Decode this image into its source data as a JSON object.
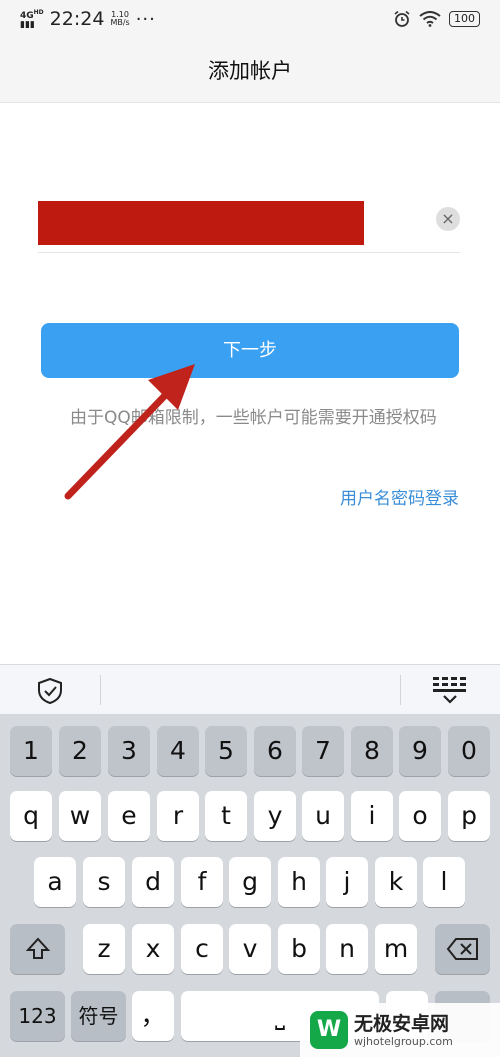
{
  "status_bar": {
    "network": "4G",
    "network_sup": "HD",
    "time": "22:24",
    "speed_value": "1.10",
    "speed_unit": "MB/s",
    "dots": "···",
    "battery": "100"
  },
  "header": {
    "title": "添加帐户"
  },
  "account_field": {
    "clear_icon": "×"
  },
  "next_button": {
    "label": "下一步"
  },
  "hint_text": "由于QQ邮箱限制，一些帐户可能需要开通授权码",
  "alt_login_link": "用户名密码登录",
  "keyboard": {
    "row_numbers": [
      "1",
      "2",
      "3",
      "4",
      "5",
      "6",
      "7",
      "8",
      "9",
      "0"
    ],
    "row_q": [
      "q",
      "w",
      "e",
      "r",
      "t",
      "y",
      "u",
      "i",
      "o",
      "p"
    ],
    "row_a": [
      "a",
      "s",
      "d",
      "f",
      "g",
      "h",
      "j",
      "k",
      "l"
    ],
    "row_z": [
      "z",
      "x",
      "c",
      "v",
      "b",
      "n",
      "m"
    ],
    "key_123": "123",
    "key_symbols": "符号",
    "key_comma": "，",
    "key_space": "⎵"
  },
  "watermark": {
    "logo": "W",
    "title": "无极安卓网",
    "url": "wjhotelgroup.com"
  },
  "colors": {
    "accent": "#3aa1f2",
    "link": "#3a8ed8",
    "redaction": "#bf1a10",
    "arrow": "#c0231b"
  }
}
